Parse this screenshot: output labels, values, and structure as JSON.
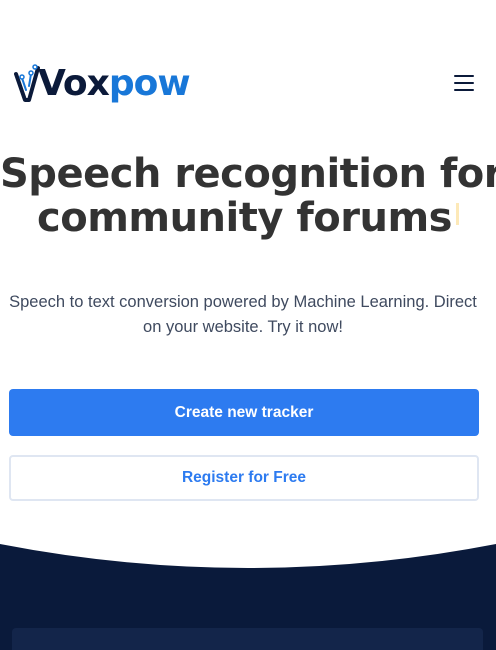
{
  "brand": {
    "logo_text_dark": "Vox",
    "logo_text_blue": "pow",
    "colors": {
      "dark": "#0b1a3a",
      "blue": "#1877d8",
      "accent": "#2d7bf0",
      "highlight": "#fde9b8",
      "footer": "#0a1a3b"
    }
  },
  "nav": {
    "menu_icon": "hamburger-menu-icon"
  },
  "hero": {
    "title_line1": "Speech recognition for",
    "title_line2": "community forums",
    "subtitle": "Speech to text conversion powered by Machine Learning. Direct on your website. Try it now!"
  },
  "buttons": {
    "primary_label": "Create new tracker",
    "secondary_label": "Register for Free"
  }
}
